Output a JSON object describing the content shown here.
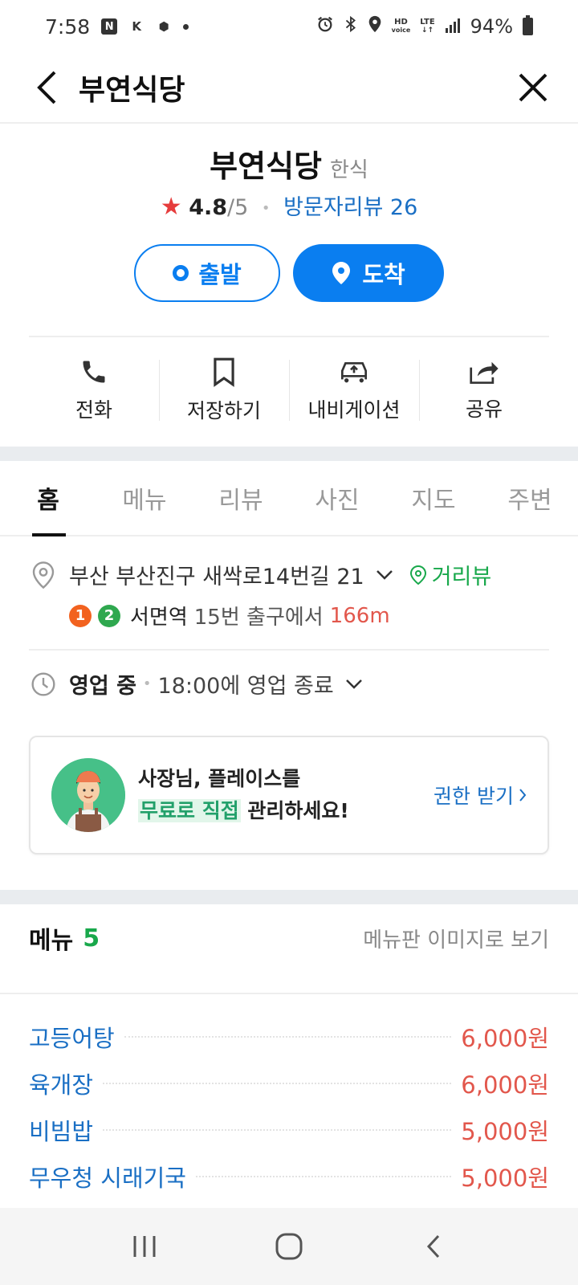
{
  "status_bar": {
    "time": "7:58",
    "left_icons": [
      "N",
      "K",
      "⬢"
    ],
    "hd": "HD",
    "voice": "voice",
    "lte": "LTE",
    "battery": "94%"
  },
  "header": {
    "title": "부연식당"
  },
  "place": {
    "name": "부연식당",
    "category": "한식",
    "rating": "4.8",
    "rating_max": "/5",
    "review_label": "방문자리뷰 26"
  },
  "buttons": {
    "start": "출발",
    "arrive": "도착"
  },
  "actions": [
    {
      "label": "전화",
      "icon": "phone-icon"
    },
    {
      "label": "저장하기",
      "icon": "bookmark-icon"
    },
    {
      "label": "내비게이션",
      "icon": "navigation-car-icon"
    },
    {
      "label": "공유",
      "icon": "share-icon"
    }
  ],
  "tabs": [
    "홈",
    "메뉴",
    "리뷰",
    "사진",
    "지도",
    "주변"
  ],
  "info": {
    "address": "부산 부산진구 새싹로14번길 21",
    "streetview": "거리뷰",
    "line1": "1",
    "line2": "2",
    "station": "서면역",
    "exit": "15번 출구에서",
    "distance": "166m",
    "open_status": "영업 중",
    "hours": "18:00에 영업 종료"
  },
  "owner_card": {
    "line1": "사장님, 플레이스를",
    "line2_highlight": "무료로 직접",
    "line2_rest": " 관리하세요!",
    "link": "권한 받기"
  },
  "menu": {
    "title": "메뉴",
    "count": "5",
    "board_link": "메뉴판 이미지로 보기",
    "items": [
      {
        "name": "고등어탕",
        "price": "6,000원"
      },
      {
        "name": "육개장",
        "price": "6,000원"
      },
      {
        "name": "비빔밥",
        "price": "5,000원"
      },
      {
        "name": "무우청 시래기국",
        "price": "5,000원"
      }
    ]
  },
  "colors": {
    "accent_blue": "#0a7ef0",
    "link_blue": "#1a6fc4",
    "green": "#18a84b",
    "price_red": "#e2574c",
    "star_red": "#e63c3c",
    "line1_orange": "#f2621f",
    "line2_green": "#2fa84f"
  }
}
